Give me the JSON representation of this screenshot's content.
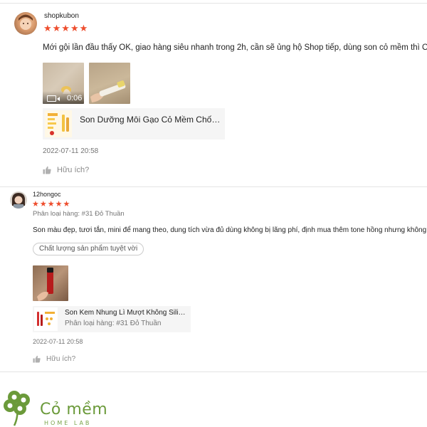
{
  "reviews": [
    {
      "username": "shopkubon",
      "stars": "★★★★★",
      "comment": "Mới gội lần đầu thấy OK, giao hàng siêu nhanh trong 2h, cần sẽ ủng hộ Shop tiếp, dùng son cỏ mềm thì OK",
      "video_duration": "0:06",
      "product_name": "Son Dưỡng Môi Gạo Cỏ Mềm Chống...",
      "timestamp": "2022-07-11 20:58",
      "helpful_label": "Hữu ích?"
    },
    {
      "username": "12hongoc",
      "stars": "★★★★★",
      "variation": "Phân loại hàng: #31 Đỏ Thuần",
      "comment": "Son màu đẹp, tươi tắn, mini để mang theo, dung tích vừa đủ dùng không bị lãng phí, định mua thêm tone hồng nhưng không có",
      "tag": "Chất lượng sản phẩm tuyệt vời",
      "product_name": "Son Kem Nhung Lì Mượt Không Silic...",
      "product_variation": "Phân loại hàng: #31 Đỏ Thuần",
      "timestamp": "2022-07-11 20:58",
      "helpful_label": "Hữu ích?"
    }
  ],
  "logo": {
    "word": "Cỏ mềm",
    "sub": "HOME LAB"
  },
  "colors": {
    "star": "#ee4d2d",
    "brand_green": "#6b9a3a"
  }
}
